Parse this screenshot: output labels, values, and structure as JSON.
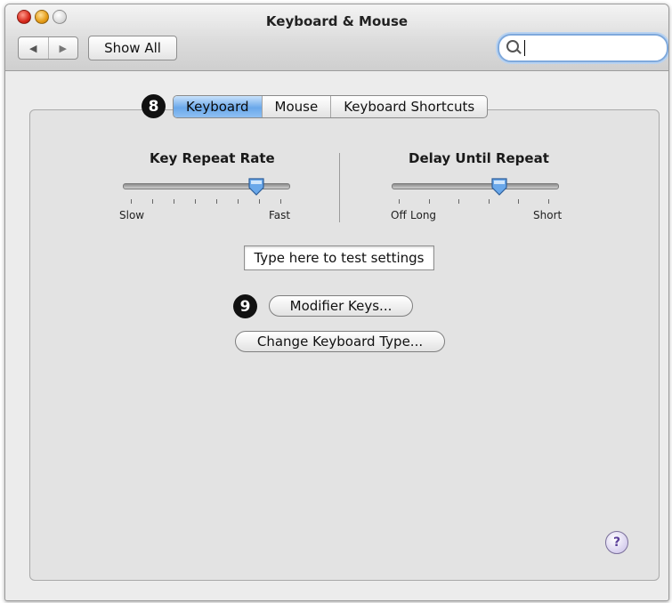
{
  "window": {
    "title": "Keyboard & Mouse"
  },
  "toolbar": {
    "back_icon": "◀",
    "forward_icon": "▶",
    "show_all": "Show All",
    "search": {
      "value": "",
      "placeholder": ""
    }
  },
  "tabs": [
    {
      "label": "Keyboard",
      "selected": true
    },
    {
      "label": "Mouse",
      "selected": false
    },
    {
      "label": "Keyboard Shortcuts",
      "selected": false
    }
  ],
  "callouts": {
    "tabs": "8",
    "modifier": "9"
  },
  "key_repeat": {
    "title": "Key Repeat Rate",
    "min_label": "Slow",
    "max_label": "Fast",
    "tick_count": 8,
    "value_step": 6
  },
  "delay_repeat": {
    "title": "Delay Until Repeat",
    "off_label": "Off",
    "min_label": "Long",
    "max_label": "Short",
    "tick_count": 6,
    "value_step": 4
  },
  "test_field": {
    "value": "Type here to test settings"
  },
  "buttons": {
    "modifier_keys": "Modifier Keys...",
    "change_type": "Change Keyboard Type..."
  },
  "help": {
    "label": "?"
  },
  "colors": {
    "accent": "#6aa8ea",
    "callout": "#111111"
  }
}
